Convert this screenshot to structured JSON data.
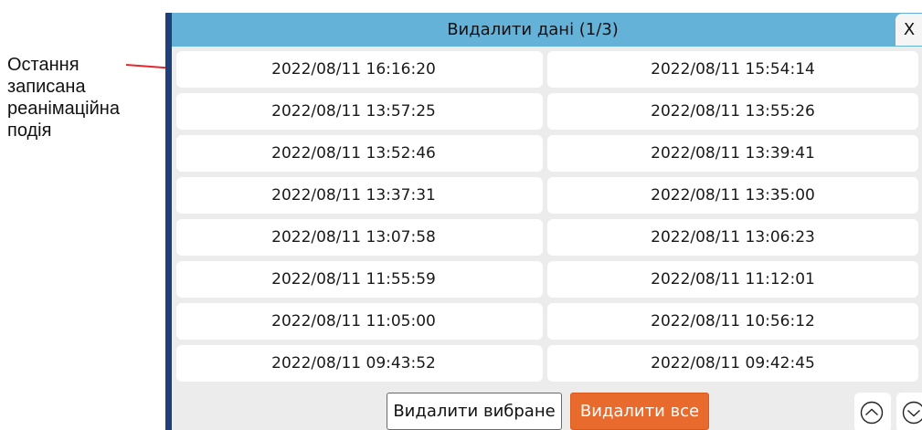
{
  "annotation": {
    "text": "Остання\nзаписана\nреанімаційна\nподія"
  },
  "dialog": {
    "title": "Видалити дані (1/3)",
    "close_label": "X"
  },
  "records": [
    "2022/08/11 16:16:20",
    "2022/08/11 15:54:14",
    "2022/08/11 13:57:25",
    "2022/08/11 13:55:26",
    "2022/08/11 13:52:46",
    "2022/08/11 13:39:41",
    "2022/08/11 13:37:31",
    "2022/08/11 13:35:00",
    "2022/08/11 13:07:58",
    "2022/08/11 13:06:23",
    "2022/08/11 11:55:59",
    "2022/08/11 11:12:01",
    "2022/08/11 11:05:00",
    "2022/08/11 10:56:12",
    "2022/08/11 09:43:52",
    "2022/08/11 09:42:45"
  ],
  "buttons": {
    "delete_selected": "Видалити вибране",
    "delete_all": "Видалити все"
  },
  "icons": {
    "scroll_up": "chevron-up-circle-icon",
    "scroll_down": "chevron-down-circle-icon"
  },
  "colors": {
    "title_bar": "#65b2d9",
    "panel_border": "#1e3f78",
    "delete_all_bg": "#e86a2c",
    "callout_line": "#e8262c"
  }
}
